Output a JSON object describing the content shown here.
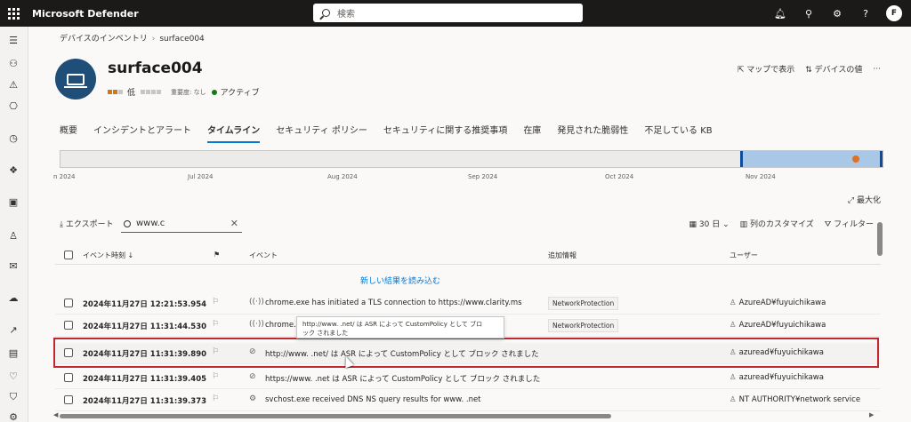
{
  "topbar": {
    "app_title": "Microsoft Defender",
    "search_placeholder": "検索",
    "avatar_initial": "F"
  },
  "breadcrumb": {
    "parent": "デバイスのインベントリ",
    "current": "surface004"
  },
  "device": {
    "name": "surface004",
    "risk_level": "低",
    "importance": "重要度: なし",
    "status": "アクティブ"
  },
  "header_actions": {
    "map": "マップで表示",
    "values": "デバイスの値"
  },
  "tabs": [
    {
      "label": "概要"
    },
    {
      "label": "インシデントとアラート"
    },
    {
      "label": "タイムライン"
    },
    {
      "label": "セキュリティ ポリシー"
    },
    {
      "label": "セキュリティに関する推奨事項"
    },
    {
      "label": "在庫"
    },
    {
      "label": "発見された脆弱性"
    },
    {
      "label": "不足している KB"
    }
  ],
  "timeline_axis": [
    "n 2024",
    "Jul 2024",
    "Aug 2024",
    "Sep 2024",
    "Oct 2024",
    "Nov 2024"
  ],
  "maximize_label": "最大化",
  "toolbar": {
    "export": "エクスポート",
    "filter_value": "www.c",
    "range": "30 日",
    "customize": "列のカスタマイズ",
    "filter": "フィルター"
  },
  "table": {
    "col_time": "イベント時刻 ↓",
    "col_event": "イベント",
    "col_info": "追加情報",
    "col_user": "ユーザー",
    "load_new": "新しい結果を読み込む",
    "rows": [
      {
        "time": "2024年11月27日 12:21:53.954",
        "event": "chrome.exe has initiated a TLS connection to https://www.clarity.ms",
        "tag": "NetworkProtection",
        "user": "AzureAD¥fuyuichikawa"
      },
      {
        "time": "2024年11月27日 11:31:44.530",
        "event": "chrome.e                                          n.net/",
        "tag": "NetworkProtection",
        "user": "AzureAD¥fuyuichikawa"
      },
      {
        "time": "2024年11月27日 11:31:39.890",
        "event": "http://www.        .net/ は ASR によって CustomPolicy として ブロック されました",
        "tag": "",
        "user": "azuread¥fuyuichikawa"
      },
      {
        "time": "2024年11月27日 11:31:39.405",
        "event": "https://www.        .net は ASR によって CustomPolicy として ブロック されました",
        "tag": "",
        "user": "azuread¥fuyuichikawa"
      },
      {
        "time": "2024年11月27日 11:31:39.373",
        "event": "svchost.exe received DNS NS query results for www.         .net",
        "tag": "",
        "user": "NT AUTHORITY¥network service"
      }
    ]
  },
  "tooltip": {
    "line1": "http://www.        .net/ は ASR によって CustomPolicy として ブロ",
    "line2": "ック されました"
  }
}
